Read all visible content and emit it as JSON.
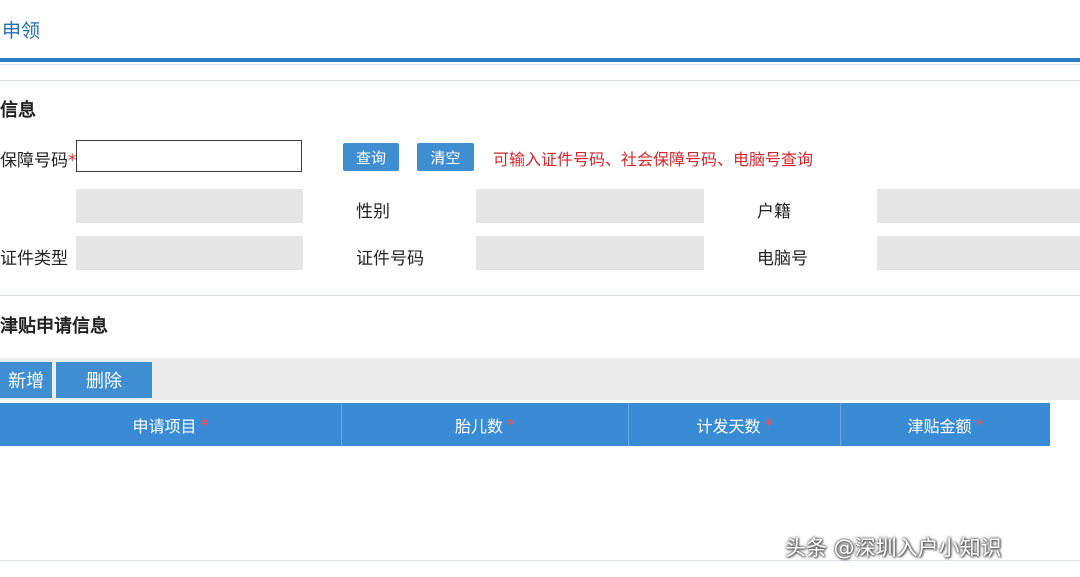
{
  "header": {
    "title": "申领"
  },
  "basic_info": {
    "title": "信息",
    "id_label": "保障号码",
    "required_mark": "*",
    "id_value": "",
    "query_button": "查询",
    "clear_button": "清空",
    "hint": "可输入证件号码、社会保障号码、电脑号查询",
    "gender_label": "性别",
    "household_label": "户籍",
    "id_type_label": "证件类型",
    "id_number_label": "证件号码",
    "computer_no_label": "电脑号"
  },
  "subsidy": {
    "title": "津贴申请信息",
    "add_button": "新增",
    "delete_button": "删除",
    "columns": [
      {
        "label": "申请项目",
        "mark": "*"
      },
      {
        "label": "胎儿数",
        "mark": "*"
      },
      {
        "label": "计发天数",
        "mark": "*"
      },
      {
        "label": "津贴金额",
        "mark": "*"
      }
    ]
  },
  "watermark": "头条 @深圳入户小知识"
}
